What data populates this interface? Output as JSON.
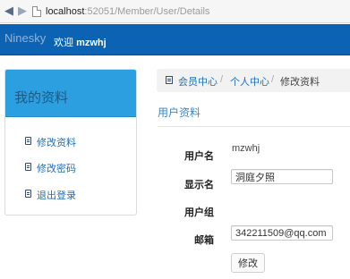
{
  "browser": {
    "url_host": "localhost",
    "url_rest": ":52051/Member/User/Details"
  },
  "navbar": {
    "brand": "Ninesky",
    "welcome_prefix": "欢迎",
    "username": "mzwhj"
  },
  "sidebar": {
    "title": "我的资料",
    "items": [
      {
        "label": "修改资料",
        "icon": "document-icon"
      },
      {
        "label": "修改密码",
        "icon": "document-icon"
      },
      {
        "label": "退出登录",
        "icon": "document-icon"
      }
    ]
  },
  "breadcrumb": {
    "items": [
      "会员中心",
      "个人中心"
    ],
    "separator": "/",
    "current": "修改资料"
  },
  "section": {
    "title": "用户资料"
  },
  "form": {
    "username_label": "用户名",
    "username_value": "mzwhj",
    "displayname_label": "显示名",
    "displayname_value": "洞庭夕照",
    "group_label": "用户组",
    "group_value": "",
    "email_label": "邮箱",
    "email_value": "342211509@qq.com",
    "submit_label": "修改"
  },
  "colors": {
    "navbar": "#0d63b3",
    "sidebar_header": "#2b9fe0",
    "link": "#1e6fb7",
    "section_title": "#3d86c5"
  }
}
